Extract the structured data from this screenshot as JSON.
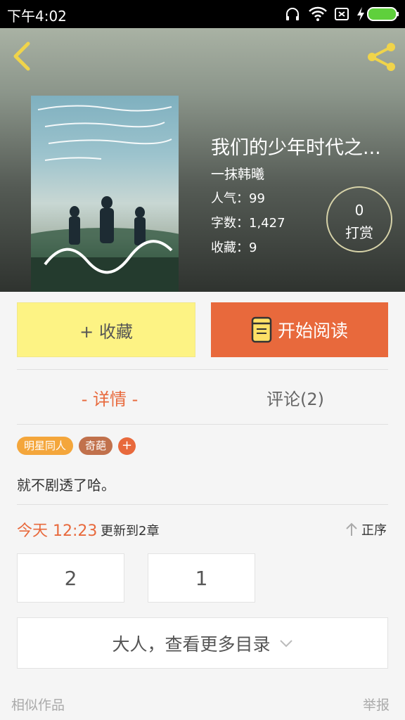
{
  "status_bar": {
    "time": "下午4:02"
  },
  "book": {
    "title": "我们的少年时代之...",
    "author": "一抹韩曦",
    "stats": [
      {
        "label": "人气：99"
      },
      {
        "label": "字数：1,427"
      },
      {
        "label": "收藏：9"
      }
    ]
  },
  "tip": {
    "count": "0",
    "label": "打赏"
  },
  "actions": {
    "favorite": "+ 收藏",
    "read": "开始阅读"
  },
  "tabs": {
    "detail": "- 详情 -",
    "comments": "评论(2)"
  },
  "tags": [
    "明星同人",
    "奇葩"
  ],
  "tag_add": "+",
  "description": "就不剧透了哈。",
  "update": {
    "time": "今天 12:23",
    "text": "更新到2章"
  },
  "sort": "正序",
  "chapters": [
    "2",
    "1"
  ],
  "more_catalog": "大人，查看更多目录",
  "footer": {
    "similar": "相似作品",
    "report": "举报"
  },
  "colors": {
    "accent": "#e8693c",
    "favorite_bg": "#fdf384",
    "tag_orange": "#f4a63b",
    "tag_brown": "#c1714c"
  }
}
